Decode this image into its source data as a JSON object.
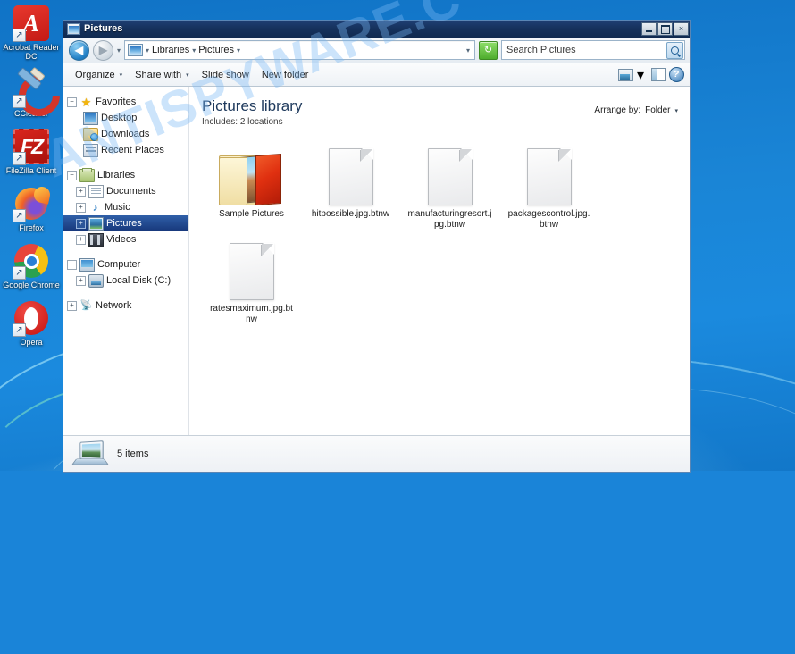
{
  "desktop": {
    "icons": [
      {
        "name": "Acrobat Reader DC",
        "icon": "acrobat-icon"
      },
      {
        "name": "CCleaner",
        "icon": "ccleaner-icon"
      },
      {
        "name": "FileZilla Client",
        "icon": "filezilla-icon"
      },
      {
        "name": "Firefox",
        "icon": "firefox-icon"
      },
      {
        "name": "Google Chrome",
        "icon": "chrome-icon"
      },
      {
        "name": "Opera",
        "icon": "opera-icon"
      }
    ]
  },
  "watermark": {
    "text": "ANTISPYWARE.C"
  },
  "window": {
    "title": "Pictures",
    "controls": {
      "minimize": "_",
      "maximize": "□",
      "close": "×"
    },
    "nav": {
      "back": "◀",
      "forward": "▶",
      "history_dropdown": "▾"
    },
    "breadcrumb": {
      "items": [
        "Libraries",
        "Pictures"
      ],
      "separator": "▸",
      "dropdown": "▾"
    },
    "refresh": {
      "glyph": "↻",
      "label": "Refresh"
    },
    "search": {
      "placeholder": "Search Pictures",
      "value": ""
    },
    "toolbar": {
      "items": [
        {
          "label": "Organize",
          "has_caret": true
        },
        {
          "label": "Share with",
          "has_caret": true
        },
        {
          "label": "Slide show",
          "has_caret": false
        },
        {
          "label": "New folder",
          "has_caret": false
        }
      ],
      "view_caret": "▾",
      "view_icon": "change-view-icon",
      "pane_icon": "preview-pane-icon",
      "help_icon": "help-icon",
      "help_glyph": "?"
    }
  },
  "navpane": {
    "groups": [
      {
        "header": {
          "label": "Favorites",
          "icon": "star-icon",
          "expander": "−",
          "indent": 0
        },
        "children": [
          {
            "label": "Desktop",
            "icon": "desktop-icon",
            "expander": "none",
            "indent": 1
          },
          {
            "label": "Downloads",
            "icon": "downloads-icon",
            "expander": "none",
            "indent": 1
          },
          {
            "label": "Recent Places",
            "icon": "recent-places-icon",
            "expander": "none",
            "indent": 1
          }
        ]
      },
      {
        "header": {
          "label": "Libraries",
          "icon": "libraries-icon",
          "expander": "−",
          "indent": 0
        },
        "children": [
          {
            "label": "Documents",
            "icon": "documents-icon",
            "expander": "+",
            "indent": 1
          },
          {
            "label": "Music",
            "icon": "music-icon",
            "expander": "+",
            "indent": 1
          },
          {
            "label": "Pictures",
            "icon": "pictures-icon",
            "expander": "+",
            "indent": 1,
            "selected": true
          },
          {
            "label": "Videos",
            "icon": "videos-icon",
            "expander": "+",
            "indent": 1
          }
        ]
      },
      {
        "header": {
          "label": "Computer",
          "icon": "computer-icon",
          "expander": "−",
          "indent": 0
        },
        "children": [
          {
            "label": "Local Disk (C:)",
            "icon": "disk-icon",
            "expander": "+",
            "indent": 1
          }
        ]
      },
      {
        "header": {
          "label": "Network",
          "icon": "network-icon",
          "expander": "+",
          "indent": 0
        },
        "children": []
      }
    ]
  },
  "content": {
    "library_title": "Pictures library",
    "includes_label": "Includes:",
    "includes_value": "2 locations",
    "arrange_label": "Arrange by:",
    "arrange_value": "Folder",
    "arrange_caret": "▾",
    "files": [
      {
        "name": "Sample Pictures",
        "type": "folder"
      },
      {
        "name": "hitpossible.jpg.btnw",
        "type": "file"
      },
      {
        "name": "manufacturingresort.jpg.btnw",
        "type": "file"
      },
      {
        "name": "packagescontrol.jpg.btnw",
        "type": "file"
      },
      {
        "name": "ratesmaximum.jpg.btnw",
        "type": "file"
      }
    ]
  },
  "statusbar": {
    "text": "5 items",
    "icon": "pictures-library-icon"
  },
  "colors": {
    "desktop_blue": "#1a84d8",
    "titlebar": "#16325d",
    "selection": "#2f5fa8",
    "watermark": "#78b9f5",
    "ransom_extension": ".btnw"
  }
}
